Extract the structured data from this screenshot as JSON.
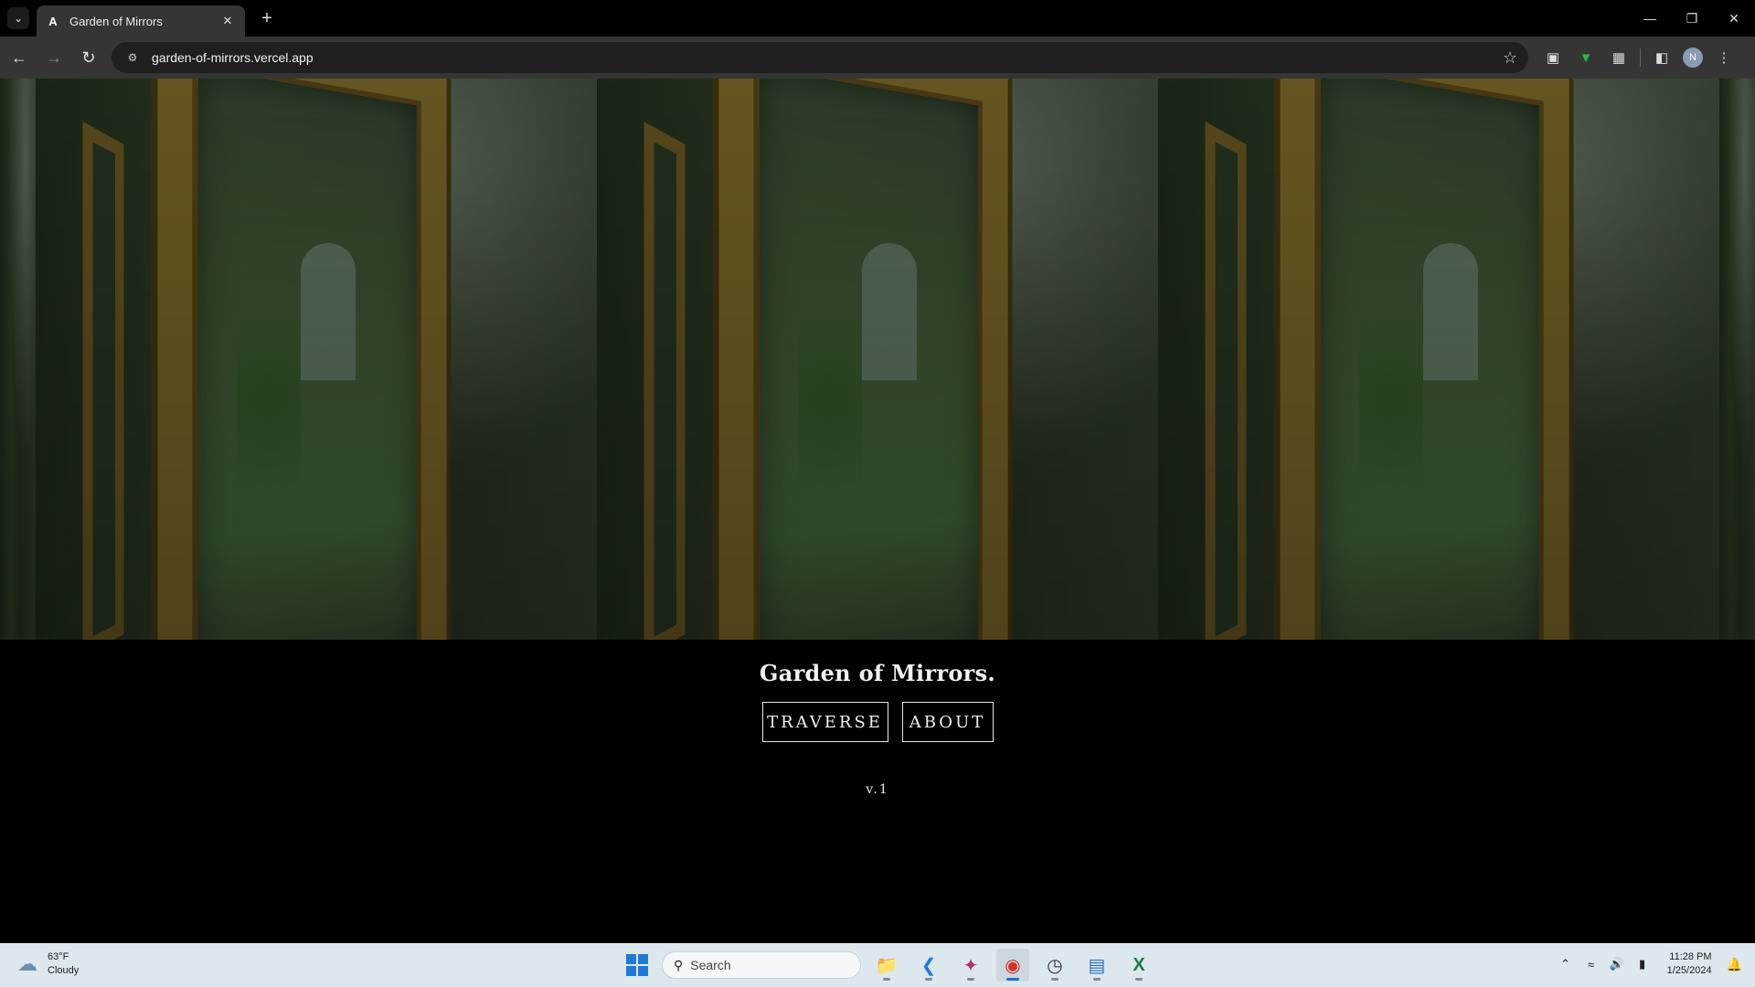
{
  "browser": {
    "tab_title": "Garden of Mirrors",
    "tab_favicon": "A",
    "url": "garden-of-mirrors.vercel.app",
    "profile_initial": "N",
    "icons": {
      "tab_menu": "chevron-down-icon",
      "close": "close-icon",
      "new_tab": "plus-icon",
      "back": "back-arrow-icon",
      "forward": "forward-arrow-icon",
      "reload": "reload-icon",
      "site_info": "site-info-icon",
      "bookmark": "star-icon"
    }
  },
  "page": {
    "title": "Garden of Mirrors.",
    "buttons": {
      "traverse": "TRAVERSE",
      "about": "ABOUT"
    },
    "version": "v.1",
    "hero_image_description": "ornate gilded mirror in overgrown garden, repeated"
  },
  "taskbar": {
    "weather_temp": "63°F",
    "weather_condition": "Cloudy",
    "search_placeholder": "Search",
    "time": "11:28 PM",
    "date": "1/25/2024",
    "accent": "#1f7ad6"
  }
}
